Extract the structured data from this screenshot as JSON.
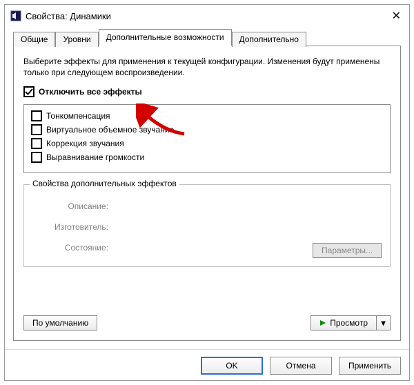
{
  "window": {
    "title": "Свойства: Динамики"
  },
  "tabs": {
    "general": "Общие",
    "levels": "Уровни",
    "enhancements": "Дополнительные возможности",
    "advanced": "Дополнительно"
  },
  "intro": "Выберите эффекты для применения к текущей конфигурации. Изменения будут применены только при следующем воспроизведении.",
  "disable_all": {
    "label": "Отключить все эффекты",
    "checked": true
  },
  "effects": [
    {
      "label": "Тонкомпенсация",
      "checked": false
    },
    {
      "label": "Виртуальное объемное звучание",
      "checked": false
    },
    {
      "label": "Коррекция звучания",
      "checked": false
    },
    {
      "label": "Выравнивание громкости",
      "checked": false
    }
  ],
  "groupbox": {
    "legend": "Свойства дополнительных эффектов",
    "desc_label": "Описание:",
    "desc_value": "",
    "vendor_label": "Изготовитель:",
    "vendor_value": "",
    "state_label": "Состояние:",
    "state_value": "",
    "params_btn": "Параметры..."
  },
  "bottom": {
    "defaults": "По умолчанию",
    "preview": "Просмотр"
  },
  "dlg": {
    "ok": "OK",
    "cancel": "Отмена",
    "apply": "Применить"
  }
}
